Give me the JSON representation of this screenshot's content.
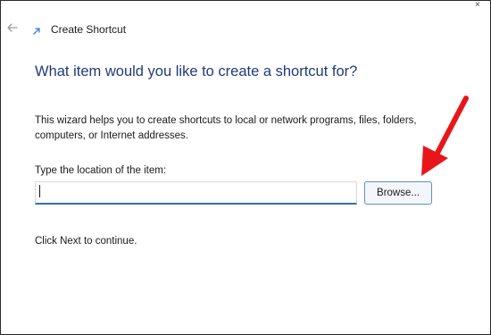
{
  "window": {
    "title": "Create Shortcut",
    "back_icon": "back-arrow-icon",
    "title_icon": "shortcut-icon",
    "close_glyph": "×"
  },
  "main": {
    "heading": "What item would you like to create a shortcut for?",
    "description": "This wizard helps you to create shortcuts to local or network programs, files, folders, computers, or Internet addresses.",
    "location_label": "Type the location of the item:",
    "location_value": "",
    "browse_label": "Browse...",
    "continue_text": "Click Next to continue."
  },
  "annotation": {
    "arrow_color": "#e8161b",
    "arrow_icon": "red-arrow-annotation"
  },
  "colors": {
    "heading": "#1e3b78",
    "input_focus": "#2f6fb8",
    "button_border": "#5b8fd3"
  }
}
